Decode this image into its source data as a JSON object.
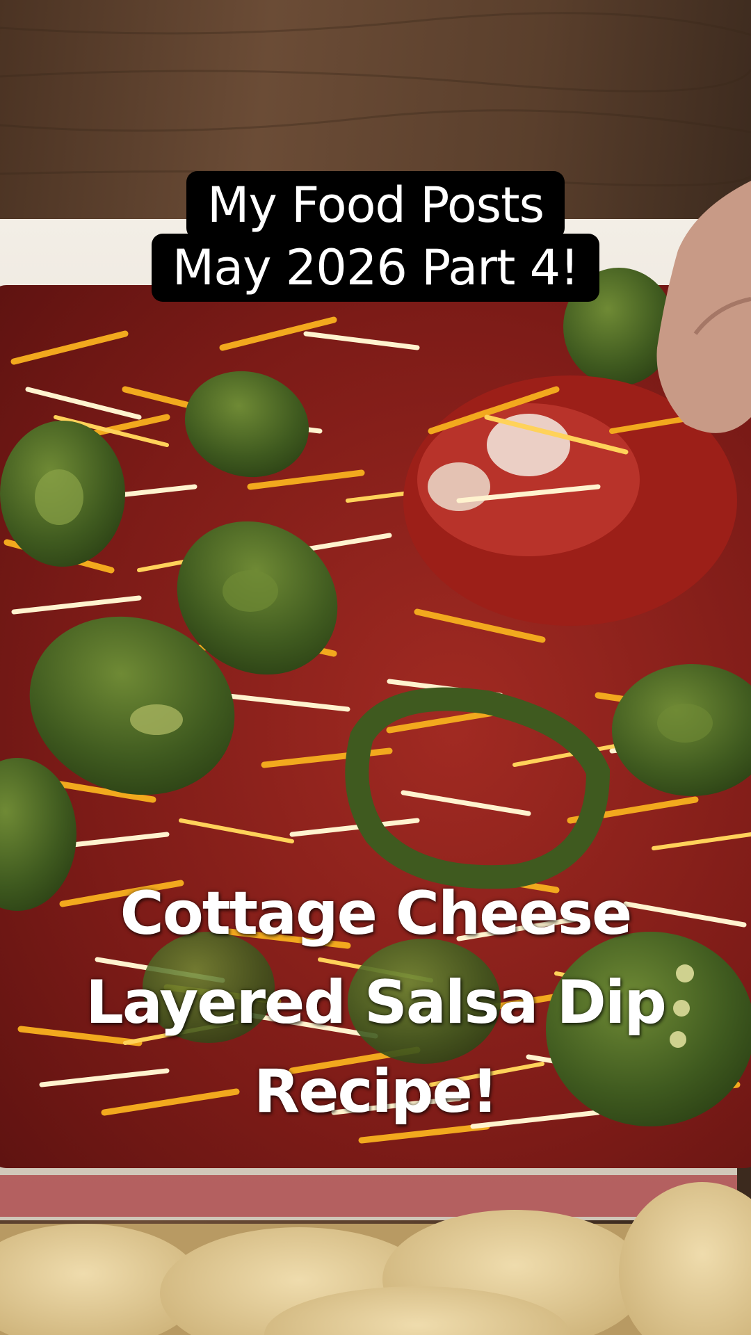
{
  "overlay_top": {
    "line1": "My Food Posts",
    "line2": "May 2026 Part 4!"
  },
  "overlay_main": {
    "line1": "Cottage Cheese",
    "line2": "Layered Salsa Dip",
    "line3": "Recipe!"
  },
  "colors": {
    "wood_table": "#5a3f2c",
    "dish_rim": "#e9e3d8",
    "salsa": "#8a1e1a",
    "cheddar": "#f2a91e",
    "jalapeno": "#3e5620",
    "tortilla_chip": "#e3cf9c"
  }
}
